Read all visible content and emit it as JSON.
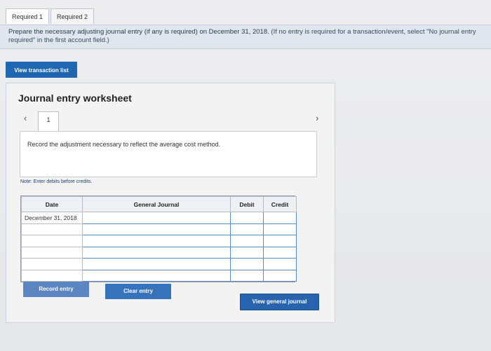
{
  "tabs": [
    {
      "label": "Required 1"
    },
    {
      "label": "Required 2"
    }
  ],
  "instructions": {
    "main": "Prepare the necessary adjusting journal entry (if any is required) on December 31, 2018.",
    "paren": "(If no entry is required for a transaction/event, select \"No journal entry required\" in the first account field.)"
  },
  "view_transaction_list_label": "View transaction list",
  "worksheet": {
    "title": "Journal entry worksheet",
    "prev_icon": "‹",
    "next_icon": "›",
    "step": "1",
    "description": "Record the adjustment necessary to reflect the average cost method.",
    "note": "Note: Enter debits before credits.",
    "columns": {
      "date": "Date",
      "general_journal": "General Journal",
      "debit": "Debit",
      "credit": "Credit"
    },
    "rows": [
      {
        "date": "December 31, 2018",
        "account": "",
        "debit": "",
        "credit": ""
      },
      {
        "date": "",
        "account": "",
        "debit": "",
        "credit": ""
      },
      {
        "date": "",
        "account": "",
        "debit": "",
        "credit": ""
      },
      {
        "date": "",
        "account": "",
        "debit": "",
        "credit": ""
      },
      {
        "date": "",
        "account": "",
        "debit": "",
        "credit": ""
      },
      {
        "date": "",
        "account": "",
        "debit": "",
        "credit": ""
      }
    ],
    "buttons": {
      "record": "Record entry",
      "clear": "Clear entry",
      "view_journal": "View general journal"
    }
  }
}
